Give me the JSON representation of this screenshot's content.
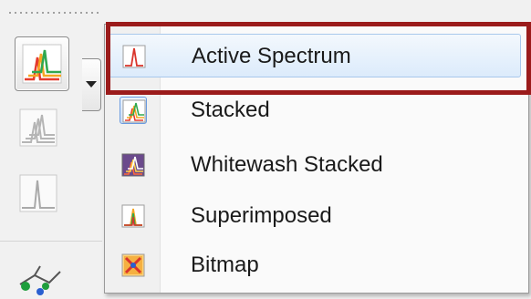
{
  "toolbar": {
    "buttons": [
      {
        "icon": "spectrum-stacked-colored-icon"
      },
      {
        "icon": "spectrum-stacked-gray-icon"
      },
      {
        "icon": "spectrum-single-gray-icon"
      },
      {
        "icon": "structure-icon"
      }
    ],
    "dropdown_icon": "chevron-down-icon"
  },
  "menu": {
    "items": [
      {
        "label": "Active Spectrum",
        "icon": "active-spectrum-icon",
        "state": "hover"
      },
      {
        "label": "Stacked",
        "icon": "stacked-icon",
        "state": "checked"
      },
      {
        "label": "Whitewash Stacked",
        "icon": "whitewash-stacked-icon",
        "state": "normal"
      },
      {
        "label": "Superimposed",
        "icon": "superimposed-icon",
        "state": "normal"
      },
      {
        "label": "Bitmap",
        "icon": "bitmap-icon",
        "state": "normal"
      }
    ]
  },
  "colors": {
    "highlight_border": "#9b1b1b",
    "hover_fill": "#dcebfb",
    "hover_border": "#a8c8ec"
  }
}
